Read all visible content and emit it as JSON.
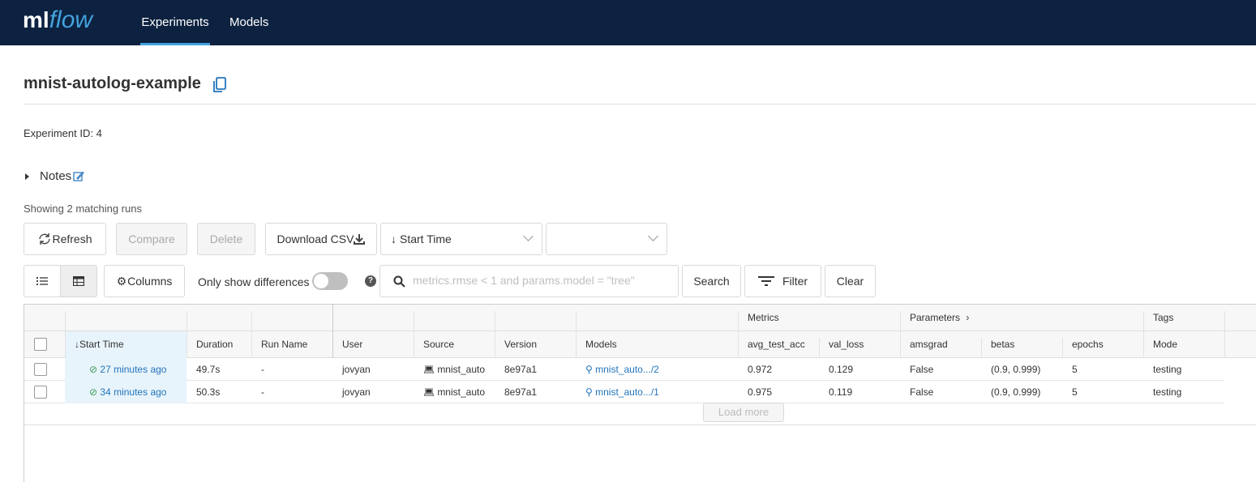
{
  "header": {
    "logo_ml": "ml",
    "logo_flow": "flow",
    "tabs": [
      {
        "label": "Experiments",
        "active": true
      },
      {
        "label": "Models",
        "active": false
      }
    ]
  },
  "experiment": {
    "name": "mnist-autolog-example",
    "id_label": "Experiment ID:",
    "id_value": "4",
    "notes_label": "Notes"
  },
  "runs_summary": "Showing 2 matching runs",
  "toolbar": {
    "refresh": "Refresh",
    "compare": "Compare",
    "delete": "Delete",
    "download_csv": "Download CSV",
    "sort_by": "Start Time",
    "columns": "Columns",
    "only_diff": "Only show differences",
    "search_placeholder": "metrics.rmse < 1 and params.model = \"tree\"",
    "search": "Search",
    "filter": "Filter",
    "clear": "Clear"
  },
  "table": {
    "groups": {
      "metrics": "Metrics",
      "parameters": "Parameters",
      "tags": "Tags"
    },
    "columns": [
      "Start Time",
      "Duration",
      "Run Name",
      "User",
      "Source",
      "Version",
      "Models",
      "avg_test_acc",
      "val_loss",
      "amsgrad",
      "betas",
      "epochs",
      "Mode"
    ],
    "rows": [
      {
        "start": "27 minutes ago",
        "duration": "49.7s",
        "run_name": "-",
        "user": "jovyan",
        "source": "mnist_auto",
        "version": "8e97a1",
        "model": "mnist_auto.../2",
        "avg_test_acc": "0.972",
        "val_loss": "0.129",
        "amsgrad": "False",
        "betas": "(0.9, 0.999)",
        "epochs": "5",
        "mode": "testing"
      },
      {
        "start": "34 minutes ago",
        "duration": "50.3s",
        "run_name": "-",
        "user": "jovyan",
        "source": "mnist_auto",
        "version": "8e97a1",
        "model": "mnist_auto.../1",
        "avg_test_acc": "0.975",
        "val_loss": "0.119",
        "amsgrad": "False",
        "betas": "(0.9, 0.999)",
        "epochs": "5",
        "mode": "testing"
      }
    ],
    "load_more": "Load more"
  },
  "colors": {
    "header_bg": "#0d2240",
    "accent": "#43a2dd",
    "link": "#2374bb",
    "success": "#3a9b5a"
  }
}
